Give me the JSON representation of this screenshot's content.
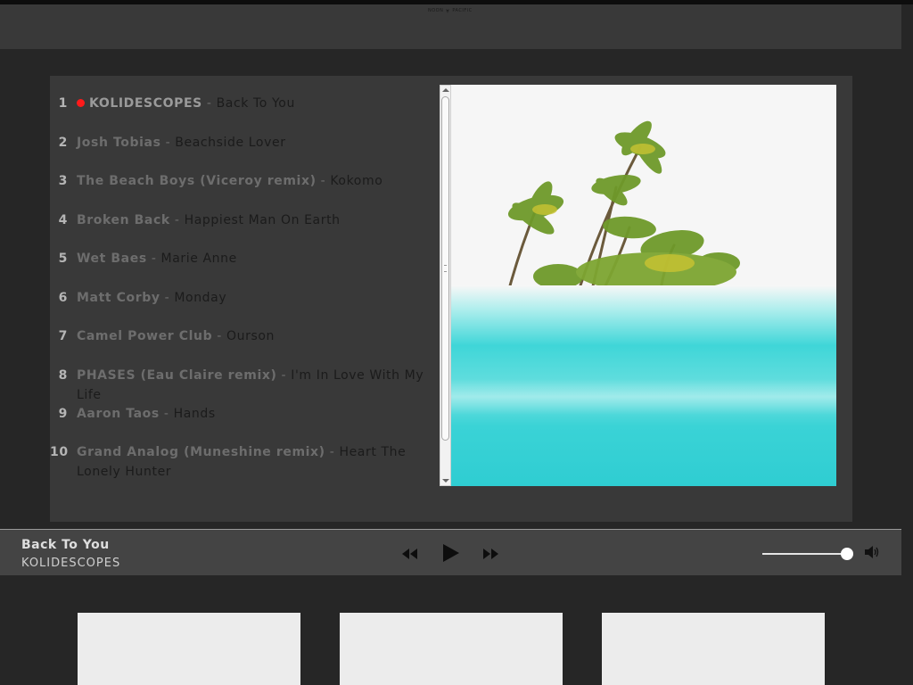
{
  "header": {
    "logo_left": "NOON",
    "logo_right": "PACIFIC",
    "logo_icon": "palm-tree-icon"
  },
  "playlist": [
    {
      "num": "1",
      "artist": "KOLIDESCOPES",
      "title": "Back To You",
      "active": true
    },
    {
      "num": "2",
      "artist": "Josh Tobias",
      "title": "Beachside Lover"
    },
    {
      "num": "3",
      "artist": "The Beach Boys (Viceroy remix)",
      "title": "Kokomo"
    },
    {
      "num": "4",
      "artist": "Broken Back",
      "title": "Happiest Man On Earth"
    },
    {
      "num": "5",
      "artist": "Wet Baes",
      "title": "Marie Anne"
    },
    {
      "num": "6",
      "artist": "Matt Corby",
      "title": "Monday"
    },
    {
      "num": "7",
      "artist": "Camel Power Club",
      "title": "Ourson"
    },
    {
      "num": "8",
      "artist": "PHASES (Eau Claire remix)",
      "title": "I'm In Love With My Life"
    },
    {
      "num": "9",
      "artist": "Aaron Taos",
      "title": "Hands"
    },
    {
      "num": "10",
      "artist": "Grand Analog (Muneshine remix)",
      "title": "Heart The Lonely Hunter"
    }
  ],
  "separator": " - ",
  "artwork": {
    "description_icon": "album-art-island-palms"
  },
  "player": {
    "now_playing_title": "Back To You",
    "now_playing_artist": "KOLIDESCOPES",
    "prev_icon": "rewind-icon",
    "play_icon": "play-icon",
    "next_icon": "fast-forward-icon",
    "volume_level": 1.0,
    "volume_icon": "speaker-icon"
  },
  "colors": {
    "accent_dot": "#ff1a1a",
    "page_bg": "#262626",
    "panel_bg": "#393939",
    "player_bg": "#444444",
    "sea": "#3fd6d8"
  }
}
